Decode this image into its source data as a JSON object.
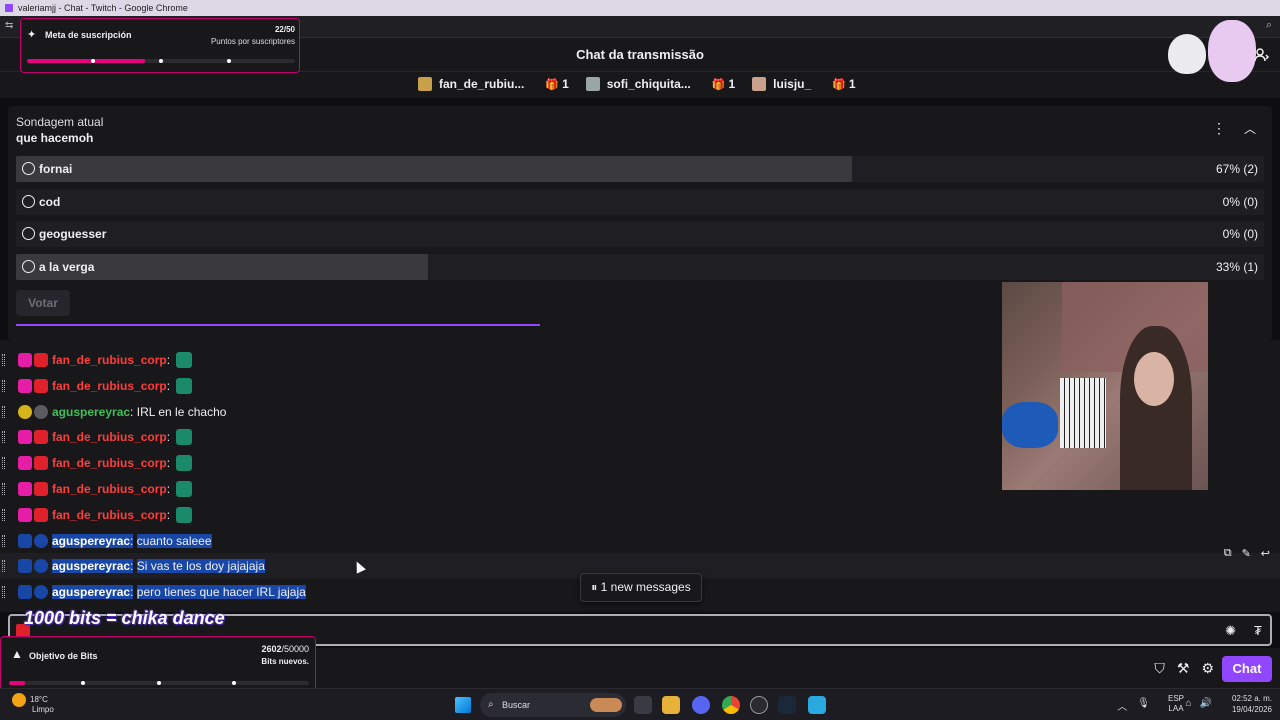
{
  "window": {
    "title": "valeriamjj - Chat - Twitch - Google Chrome"
  },
  "header": {
    "title": "Chat da transmissão"
  },
  "gifters": [
    {
      "name": "fan_de_rubiu...",
      "count": "1",
      "color": "#c9a04a"
    },
    {
      "name": "sofi_chiquita...",
      "count": "1",
      "color": "#9aa7a4"
    },
    {
      "name": "luisju_",
      "count": "1",
      "color": "#c8a08c"
    }
  ],
  "sub_goal": {
    "label": "Meta de suscripción",
    "count": "22/50",
    "sublabel": "Puntos por suscriptores",
    "progress": 0.44
  },
  "poll": {
    "kicker": "Sondagem atual",
    "question": "que hacemoh",
    "options": [
      {
        "label": "fornai",
        "result": "67% (2)",
        "fraction": 0.67
      },
      {
        "label": "cod",
        "result": "0% (0)",
        "fraction": 0
      },
      {
        "label": "geoguesser",
        "result": "0% (0)",
        "fraction": 0
      },
      {
        "label": "a la verga",
        "result": "33% (1)",
        "fraction": 0.33
      }
    ],
    "vote_label": "Votar",
    "time_remaining_fraction": 0.42
  },
  "messages": [
    {
      "user": "fan_de_rubius_corp",
      "color": "#ff3d3d",
      "text": "",
      "emote": true,
      "highlight": false
    },
    {
      "user": "fan_de_rubius_corp",
      "color": "#ff3d3d",
      "text": "",
      "emote": true,
      "highlight": false
    },
    {
      "user": "aguspereyrac",
      "color": "#3fbf58",
      "text": "IRL en le chacho",
      "emote": false,
      "highlight": false
    },
    {
      "user": "fan_de_rubius_corp",
      "color": "#ff3d3d",
      "text": "",
      "emote": true,
      "highlight": false
    },
    {
      "user": "fan_de_rubius_corp",
      "color": "#ff3d3d",
      "text": "",
      "emote": true,
      "highlight": false
    },
    {
      "user": "fan_de_rubius_corp",
      "color": "#ff3d3d",
      "text": "",
      "emote": true,
      "highlight": false
    },
    {
      "user": "fan_de_rubius_corp",
      "color": "#ff3d3d",
      "text": "",
      "emote": true,
      "highlight": false
    },
    {
      "user": "aguspereyrac",
      "color": "#ffffff",
      "text": "cuanto saleee",
      "emote": false,
      "highlight": true
    },
    {
      "user": "aguspereyrac",
      "color": "#ffffff",
      "text": "Si vas te los doy jajajaja",
      "emote": false,
      "highlight": true
    },
    {
      "user": "aguspereyrac",
      "color": "#ffffff",
      "text": "pero tienes que hacer IRL jajaja",
      "emote": false,
      "highlight": true
    }
  ],
  "new_messages": "1 new messages",
  "overlay_text": "1000 bits = chika dance",
  "chat_button": "Chat",
  "bits_goal": {
    "label": "Objetivo de Bits",
    "current": "2602",
    "target": "/50000",
    "sublabel": "Bits nuevos.",
    "progress": 0.052
  },
  "taskbar": {
    "search_placeholder": "Buscar",
    "weather_temp": "18°C",
    "weather_cond": "Limpo",
    "lang_top": "ESP",
    "lang_bottom": "LAA",
    "time": "02:52 a. m.",
    "date": "19/04/2026"
  },
  "colors": {
    "accent": "#9147ff",
    "goal_border": "#c2006e",
    "goal_fill": "#e6007e",
    "highlight": "#1847a8"
  }
}
